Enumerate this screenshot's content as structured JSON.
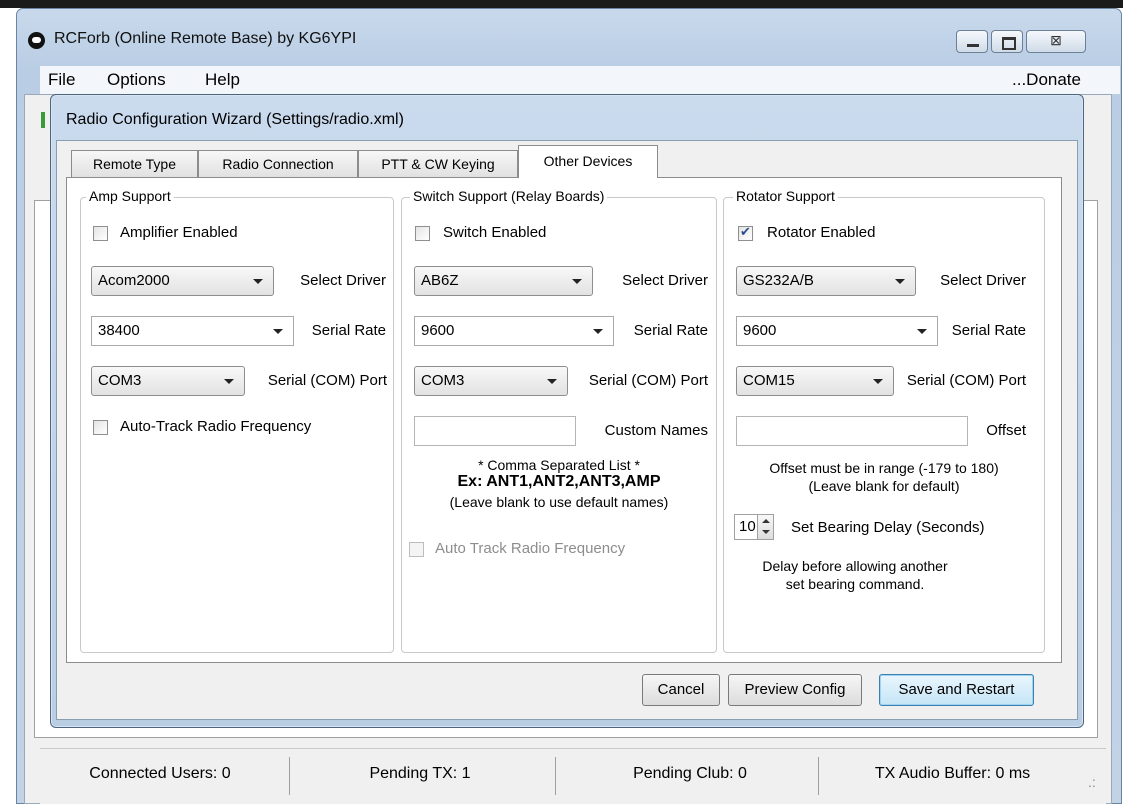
{
  "window": {
    "title": "RCForb (Online Remote Base) by KG6YPI",
    "menu": [
      "File",
      "Options",
      "Help"
    ],
    "donate_label": "...Donate",
    "close_glyph": "⊠"
  },
  "status": {
    "connected_users": "Connected Users: 0",
    "pending_tx": "Pending TX: 1",
    "pending_club": "Pending Club: 0",
    "tx_audio_buffer": "TX Audio Buffer: 0 ms",
    "grip": ".:"
  },
  "dialog": {
    "title": "Radio Configuration Wizard (Settings/radio.xml)",
    "tabs": [
      "Remote Type",
      "Radio Connection",
      "PTT & CW Keying",
      "Other Devices"
    ],
    "active_tab": "Other Devices",
    "buttons": {
      "cancel": "Cancel",
      "preview": "Preview Config",
      "save": "Save and Restart"
    }
  },
  "amp": {
    "group_title": "Amp Support",
    "enabled_label": "Amplifier Enabled",
    "enabled": false,
    "driver": "Acom2000",
    "driver_label": "Select Driver",
    "rate": "38400",
    "rate_label": "Serial Rate",
    "port": "COM3",
    "port_label": "Serial (COM) Port",
    "autotrack_label": "Auto-Track Radio Frequency",
    "autotrack": false
  },
  "switch": {
    "group_title": "Switch Support (Relay Boards)",
    "enabled_label": "Switch Enabled",
    "enabled": false,
    "driver": "AB6Z",
    "driver_label": "Select Driver",
    "rate": "9600",
    "rate_label": "Serial Rate",
    "port": "COM3",
    "port_label": "Serial (COM) Port",
    "custom_names_value": "",
    "custom_names_label": "Custom Names",
    "note1": "* Comma Separated List *",
    "note2": "Ex: ANT1,ANT2,ANT3,AMP",
    "note3": "(Leave blank to use default names)",
    "autotrack_label": "Auto Track Radio Frequency",
    "autotrack": false
  },
  "rotator": {
    "group_title": "Rotator Support",
    "enabled_label": "Rotator Enabled",
    "enabled": true,
    "driver": "GS232A/B",
    "driver_label": "Select Driver",
    "rate": "9600",
    "rate_label": "Serial Rate",
    "port": "COM15",
    "port_label": "Serial (COM) Port",
    "offset_value": "",
    "offset_label": "Offset",
    "offset_note1": "Offset must be in range (-179 to 180)",
    "offset_note2": "(Leave blank for default)",
    "bearing_delay": "10",
    "bearing_delay_label": "Set Bearing Delay (Seconds)",
    "delay_note1": "Delay before allowing another",
    "delay_note2": "set bearing command."
  }
}
